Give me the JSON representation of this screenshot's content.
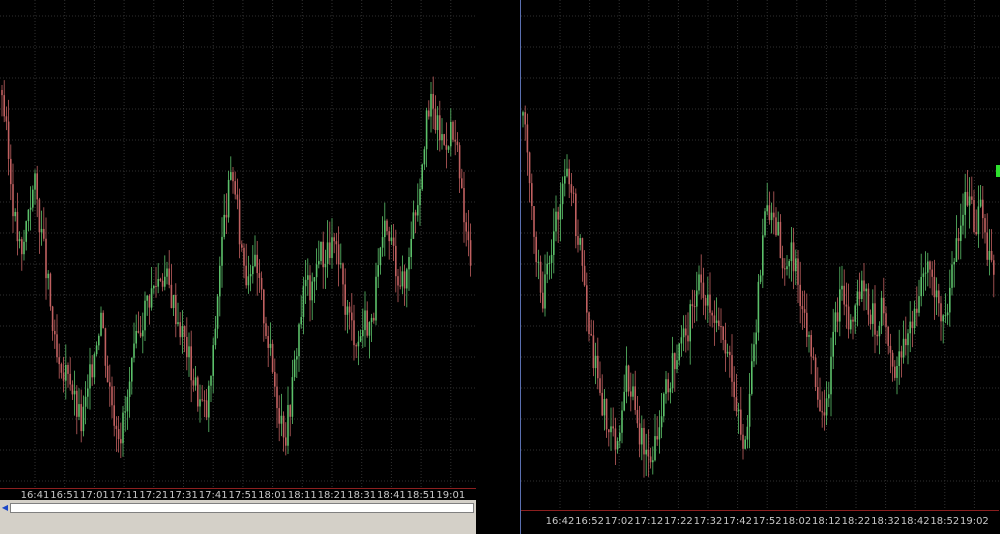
{
  "colors": {
    "up": "#5cc06a",
    "down": "#c06060",
    "grid": "#303030",
    "axis": "#8c1f1f",
    "text": "#c8c8c8",
    "marker": "#2ee02e"
  },
  "chart_data": [
    {
      "type": "candlestick",
      "title": "",
      "xlabel": "",
      "ylabel": "",
      "grid": true,
      "x_tick_labels": [
        "16:41",
        "16:51",
        "17:01",
        "17:11",
        "17:21",
        "17:31",
        "17:41",
        "17:51",
        "18:01",
        "18:11",
        "18:21",
        "18:31",
        "18:41",
        "18:51",
        "19:01"
      ],
      "ylim": [
        0,
        100
      ],
      "close_path": [
        100,
        82,
        65,
        55,
        70,
        75,
        62,
        48,
        32,
        22,
        28,
        18,
        12,
        20,
        32,
        42,
        25,
        15,
        10,
        18,
        30,
        38,
        45,
        48,
        52,
        50,
        44,
        38,
        32,
        24,
        18,
        15,
        30,
        55,
        70,
        78,
        62,
        52,
        56,
        48,
        38,
        26,
        16,
        10,
        22,
        38,
        50,
        46,
        58,
        56,
        60,
        54,
        44,
        38,
        34,
        40,
        38,
        52,
        62,
        60,
        52,
        48,
        64,
        72,
        88,
        96,
        90,
        86,
        90,
        82,
        66,
        55
      ]
    },
    {
      "type": "candlestick",
      "title": "",
      "xlabel": "",
      "ylabel": "",
      "grid": true,
      "x_tick_labels": [
        "16:42",
        "16:52",
        "17:02",
        "17:12",
        "17:22",
        "17:32",
        "17:42",
        "17:52",
        "18:02",
        "18:12",
        "18:22",
        "18:32",
        "18:42",
        "18:52",
        "19:02"
      ],
      "ylim": [
        0,
        100
      ],
      "close_path": [
        96,
        80,
        62,
        50,
        58,
        70,
        76,
        82,
        70,
        58,
        44,
        32,
        22,
        18,
        12,
        20,
        30,
        22,
        14,
        8,
        12,
        18,
        26,
        32,
        36,
        40,
        48,
        52,
        50,
        46,
        40,
        34,
        30,
        18,
        12,
        30,
        50,
        68,
        74,
        66,
        58,
        62,
        54,
        46,
        36,
        26,
        20,
        30,
        46,
        50,
        40,
        48,
        52,
        46,
        42,
        48,
        36,
        30,
        34,
        40,
        46,
        52,
        58,
        52,
        42,
        48,
        60,
        70,
        76,
        68,
        72,
        62,
        56
      ]
    }
  ]
}
